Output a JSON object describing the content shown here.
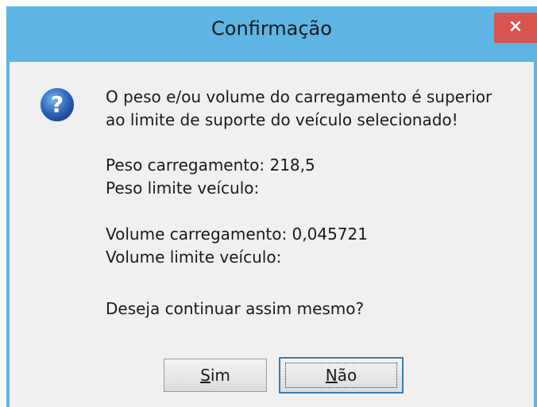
{
  "window": {
    "title": "Confirmação",
    "close_glyph": "×"
  },
  "icon": "question-icon",
  "message": {
    "line1": "O peso e/ou volume do carregamento é superior",
    "line2": "ao limite de suporte do veículo selecionado!",
    "peso_carregamento": "Peso carregamento: 218,5",
    "peso_limite": "Peso limite veículo:",
    "volume_carregamento": "Volume carregamento: 0,045721",
    "volume_limite": "Volume limite veículo:",
    "question": "Deseja continuar assim mesmo?"
  },
  "buttons": {
    "yes_mnemonic": "S",
    "yes_rest": "im",
    "no_mnemonic": "N",
    "no_rest": "ão"
  },
  "colors": {
    "titlebar": "#5eb5e3",
    "close": "#d9534f",
    "client": "#f0f0f0"
  }
}
